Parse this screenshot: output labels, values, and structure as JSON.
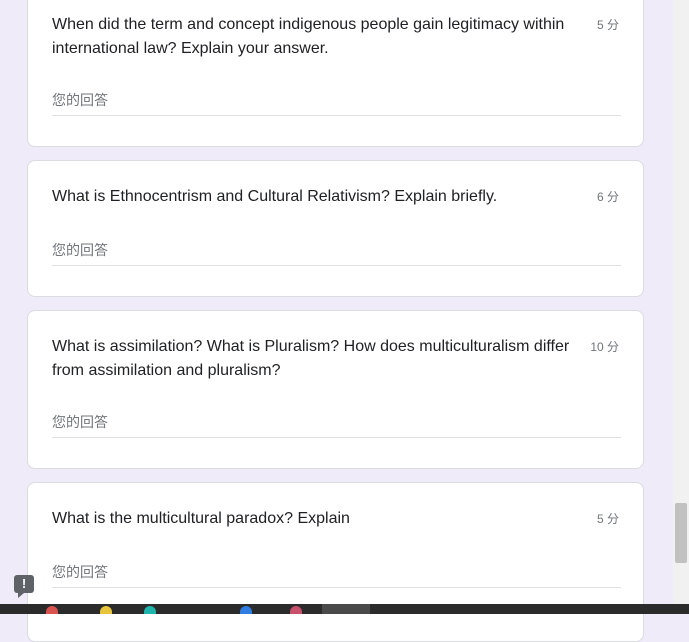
{
  "answer_placeholder": "您的回答",
  "questions": [
    {
      "text": "When did the term and concept indigenous people gain legitimacy within international law? Explain your answer.",
      "points": "5 分"
    },
    {
      "text": "What is Ethnocentrism and Cultural Relativism? Explain briefly.",
      "points": "6 分"
    },
    {
      "text": "What is assimilation? What is Pluralism? How does multiculturalism differ from assimilation and pluralism?",
      "points": "10 分"
    },
    {
      "text": "What is the multicultural paradox? Explain",
      "points": "5 分"
    }
  ],
  "feedback_icon": "report-problem-icon",
  "colors": {
    "page_background": "#f0ebf8",
    "card_background": "#ffffff",
    "text": "#202124",
    "muted": "#70757a",
    "taskbar": "#2b2b2b"
  }
}
